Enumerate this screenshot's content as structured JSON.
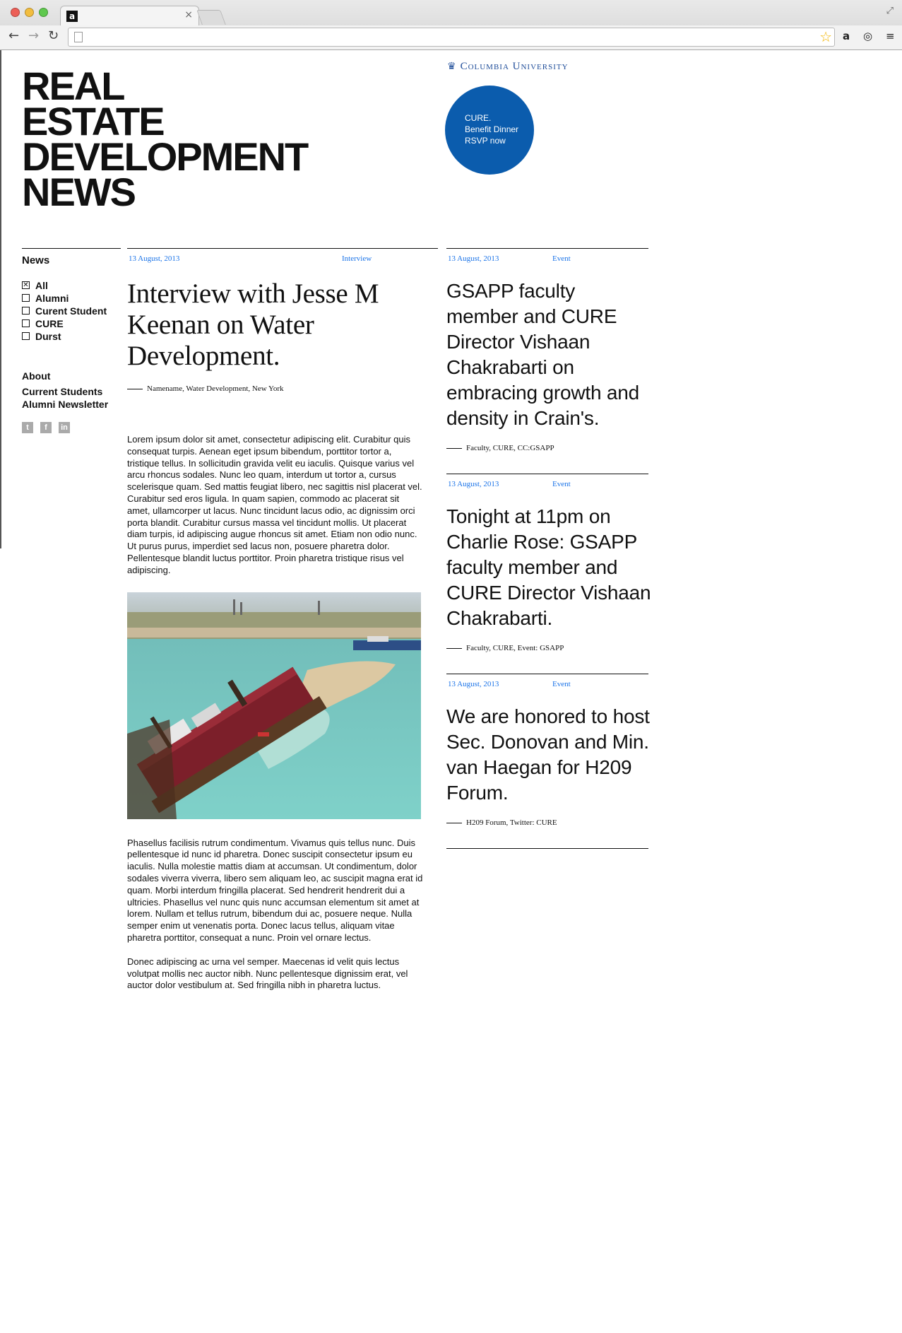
{
  "browser": {
    "tab_favicon": "a",
    "tab_close": "×",
    "fullscreen_icon": "⤢",
    "back": "←",
    "forward": "→",
    "reload": "↻",
    "star": "☆",
    "ext_amazon": "a",
    "ext_sync": "◎",
    "ext_menu": "≡"
  },
  "site": {
    "title_lines": [
      "REAL",
      "ESTATE",
      "DEVELOPMENT",
      "NEWS"
    ],
    "university": "Columbia University",
    "promo": [
      "CURE.",
      "Benefit Dinner",
      "RSVP now"
    ],
    "brand_color": "#0b5cad",
    "link_color": "#1a73e8"
  },
  "nav": {
    "heading": "News",
    "filters": [
      {
        "label": "All",
        "checked": true
      },
      {
        "label": "Alumni",
        "checked": false
      },
      {
        "label": "Curent Student",
        "checked": false
      },
      {
        "label": "CURE",
        "checked": false
      },
      {
        "label": "Durst",
        "checked": false
      }
    ],
    "links": [
      "About",
      "Current Students",
      "Alumni Newsletter"
    ],
    "social": [
      "t",
      "f",
      "in"
    ]
  },
  "main": {
    "date": "13 August, 2013",
    "category": "Interview",
    "headline": "Interview with Jesse M Keenan on Water Development.",
    "byline": "Namename, Water Development, New York",
    "paragraphs": [
      "Lorem ipsum dolor sit amet, consectetur adipiscing elit. Curabitur quis consequat turpis. Aenean eget ipsum bibendum, porttitor tortor a, tristique tellus. In sollicitudin gravida velit eu iaculis. Quisque varius vel arcu rhoncus sodales. Nunc leo quam, interdum ut tortor a, cursus scelerisque quam. Sed mattis feugiat libero, nec sagittis nisl placerat vel. Curabitur sed eros ligula. In quam sapien, commodo ac placerat sit amet, ullamcorper ut lacus. Nunc tincidunt lacus odio, ac dignissim orci porta blandit. Curabitur cursus massa vel tincidunt mollis. Ut placerat diam turpis, id adipiscing augue rhoncus sit amet. Etiam non odio nunc. Ut purus purus, imperdiet sed lacus non, posuere pharetra dolor. Pellentesque blandit luctus porttitor. Proin pharetra tristique risus vel adipiscing.",
      "Phasellus facilisis rutrum condimentum. Vivamus quis tellus nunc. Duis pellentesque id nunc id pharetra. Donec suscipit consectetur ipsum eu iaculis. Nulla molestie mattis diam at accumsan. Ut condimentum, dolor sodales viverra viverra, libero sem aliquam leo, ac suscipit magna erat id quam. Morbi interdum fringilla placerat. Sed hendrerit hendrerit dui a ultricies. Phasellus vel nunc quis nunc accumsan elementum sit amet at lorem. Nullam et tellus rutrum, bibendum dui ac, posuere neque. Nulla semper enim ut venenatis porta. Donec lacus tellus, aliquam vitae pharetra porttitor, consequat a nunc. Proin vel ornare lectus.",
      "Donec adipiscing ac urna vel semper. Maecenas id velit quis lectus volutpat mollis nec auctor nibh. Nunc pellentesque dignissim erat, vel auctor dolor vestibulum at. Sed fringilla nibh in pharetra luctus."
    ]
  },
  "posts": [
    {
      "date": "13 August, 2013",
      "category": "Event",
      "headline": "GSAPP faculty member and CURE Director Vishaan Chakrabarti on embracing growth and density in Crain's.",
      "tags": "Faculty, CURE, CC:GSAPP"
    },
    {
      "date": "13 August, 2013",
      "category": "Event",
      "headline": "Tonight at 11pm on Charlie Rose: GSAPP faculty member and CURE Director Vishaan Chakrabarti.",
      "tags": "Faculty, CURE, Event: GSAPP"
    },
    {
      "date": "13 August, 2013",
      "category": "Event",
      "headline": "We are honored to host Sec. Donovan and Min. van Haegan for H209 Forum.",
      "tags": "H209 Forum, Twitter: CURE"
    }
  ]
}
